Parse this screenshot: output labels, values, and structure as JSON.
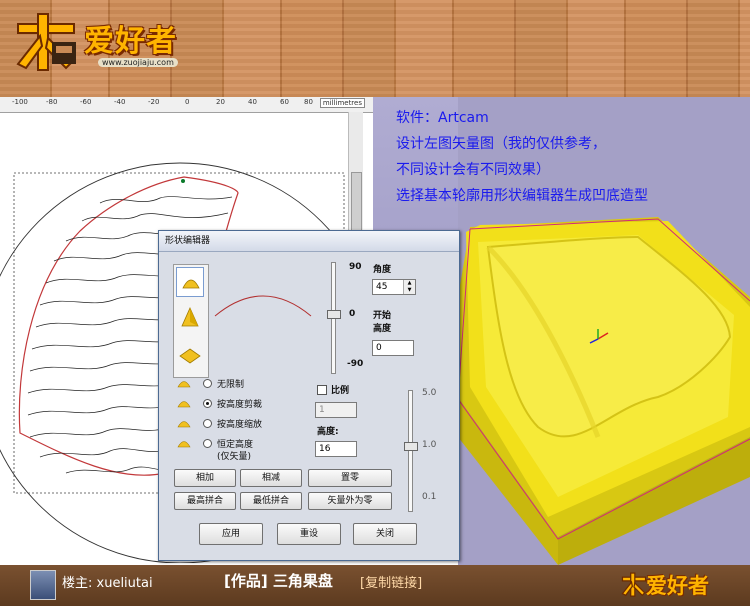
{
  "header": {
    "logo_text": "爱好者",
    "logo_url": "www.zuojiaju.com"
  },
  "ruler": {
    "ticks": [
      "-100",
      "-80",
      "-60",
      "-40",
      "-20",
      "0",
      "20",
      "40",
      "60",
      "80"
    ],
    "unit": "millimetres"
  },
  "info": {
    "lines": [
      "软件：Artcam",
      "设计左图矢量图（我的仅供参考，",
      "不同设计会有不同效果）",
      "选择基本轮廓用形状编辑器生成凹底造型"
    ],
    "color": "#1a1aee"
  },
  "dialog": {
    "title": "形状编辑器",
    "slider_left": {
      "max": "90",
      "mid": "0",
      "min": "-90"
    },
    "angle_label": "角度",
    "angle_value": "45",
    "start_height_label_1": "开始",
    "start_height_label_2": "高度",
    "start_height_value": "0",
    "radio_options": [
      {
        "label": "无限制"
      },
      {
        "label": "按高度剪裁"
      },
      {
        "label": "按高度缩放"
      },
      {
        "label": "恒定高度",
        "sub": "(仅矢量)"
      }
    ],
    "selected_radio_index": 1,
    "scale_label": "比例",
    "scale_value": "1",
    "height_label": "高度:",
    "height_value": "16",
    "slider_right": {
      "top": "5.0",
      "mid": "1.0",
      "bottom": "0.1"
    },
    "buttons_row1": [
      "相加",
      "相减",
      "置零"
    ],
    "buttons_row2": [
      "最高拼合",
      "最低拼合",
      "矢量外为零"
    ],
    "buttons_row3": [
      "应用",
      "重设",
      "关闭"
    ]
  },
  "footer": {
    "user": "楼主: xueliutai",
    "title": "[作品] 三角果盘",
    "copy_link": "[复制链接]",
    "logo_text": "爱好者"
  },
  "colors": {
    "wood": "#c98a55",
    "view_bg": "#a4a0c6",
    "tray": "#f2e01a",
    "footer": "#6a4426"
  }
}
